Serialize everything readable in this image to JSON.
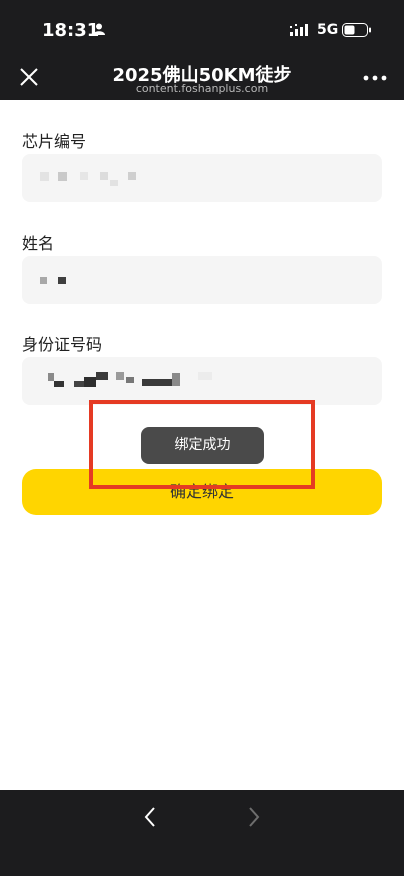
{
  "status_bar": {
    "time": "18:31",
    "network": "5G",
    "icons": [
      "person-icon",
      "signal-icon",
      "battery-icon"
    ]
  },
  "nav": {
    "title": "2025佛山50KM徒步",
    "subtitle": "content.foshanplus.com",
    "close_icon": "close-icon",
    "more_icon": "more-icon"
  },
  "form": {
    "chip_label": "芯片编号",
    "name_label": "姓名",
    "id_label": "身份证号码"
  },
  "confirm_button": "确定绑定",
  "toast": "绑定成功",
  "colors": {
    "bars": "#1c1c1e",
    "accent_yellow": "#ffd500",
    "highlight_red": "#e53a23",
    "toast_bg": "#4a4a4a"
  },
  "bottom_bar": {
    "back_icon": "chevron-left-icon",
    "forward_icon": "chevron-right-icon"
  }
}
